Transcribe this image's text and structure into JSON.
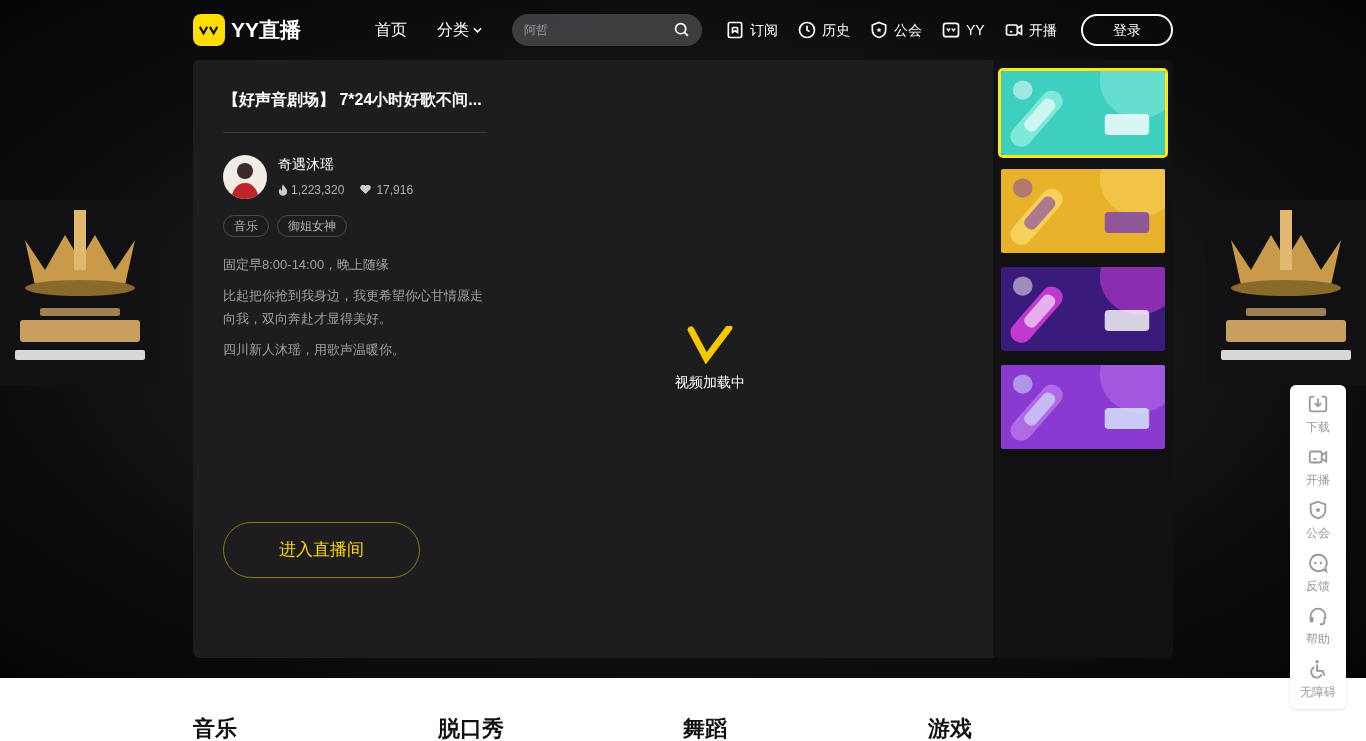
{
  "header": {
    "logo": "YY直播",
    "nav": [
      {
        "label": "首页",
        "dropdown": false
      },
      {
        "label": "分类",
        "dropdown": true
      }
    ],
    "search": {
      "placeholder": "阿哲"
    },
    "actions": [
      {
        "label": "订阅",
        "kind": "bookmark"
      },
      {
        "label": "历史",
        "kind": "clock"
      },
      {
        "label": "公会",
        "kind": "shield"
      },
      {
        "label": "YY",
        "kind": "yy"
      },
      {
        "label": "开播",
        "kind": "camera"
      }
    ],
    "login": "登录"
  },
  "room": {
    "title": "【好声音剧场】 7*24小时好歌不间...",
    "streamer": "奇遇沐瑶",
    "heat": "1,223,320",
    "likes": "17,916",
    "tags": [
      "音乐",
      "御姐女神"
    ],
    "description": [
      "固定早8:00-14:00，晚上随缘",
      "比起把你抢到我身边，我更希望你心甘情愿走向我，双向奔赴才显得美好。",
      "四川新人沐瑶，用歌声温暖你。"
    ],
    "enter_button": "进入直播间",
    "loading": "视频加载中"
  },
  "channels": [
    {
      "kind": "picture",
      "selected": true
    },
    {
      "kind": "picture",
      "selected": false
    },
    {
      "kind": "picture",
      "selected": false
    },
    {
      "kind": "picture",
      "selected": false
    }
  ],
  "side_tools": [
    {
      "label": "下载",
      "kind": "download"
    },
    {
      "label": "开播",
      "kind": "camera"
    },
    {
      "label": "公会",
      "kind": "shield"
    },
    {
      "label": "反馈",
      "kind": "chat"
    },
    {
      "label": "帮助",
      "kind": "headset"
    },
    {
      "label": "无障碍",
      "kind": "accessibility"
    }
  ],
  "categories": [
    "音乐",
    "脱口秀",
    "舞蹈",
    "游戏"
  ]
}
